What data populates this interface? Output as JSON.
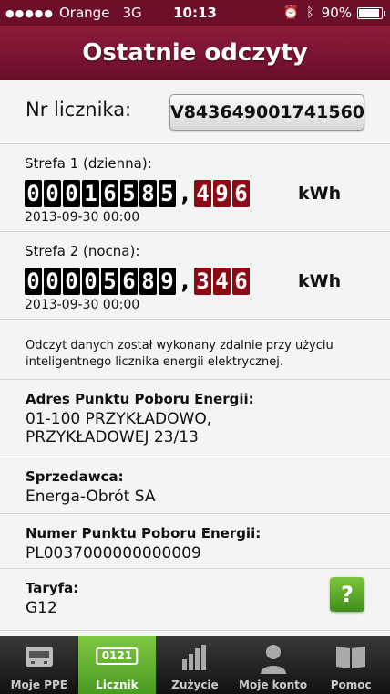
{
  "status_bar": {
    "signal": "●●●●●",
    "carrier": "Orange",
    "network": "3G",
    "time": "10:13",
    "battery": "90%"
  },
  "header": {
    "title": "Ostatnie odczyty"
  },
  "meter": {
    "label": "Nr licznika:",
    "number": "V843649001741560"
  },
  "zones": [
    {
      "label": "Strefa 1 (dzienna):",
      "digits_int": [
        "0",
        "0",
        "0",
        "1",
        "6",
        "5",
        "8",
        "5"
      ],
      "digits_dec": [
        "4",
        "9",
        "6"
      ],
      "unit": "kWh",
      "date": "2013-09-30 00:00"
    },
    {
      "label": "Strefa 2 (nocna):",
      "digits_int": [
        "0",
        "0",
        "0",
        "0",
        "5",
        "6",
        "8",
        "9"
      ],
      "digits_dec": [
        "3",
        "4",
        "6"
      ],
      "unit": "kWh",
      "date": "2013-09-30 00:00"
    }
  ],
  "note": "Odczyt danych został wykonany zdalnie przy użyciu inteligentnego licznika energii elektrycznej.",
  "address": {
    "label": "Adres Punktu Poboru Energii:",
    "line1": "01-100 PRZYKŁADOWO,",
    "line2": "PRZYKŁADOWEJ 23/13"
  },
  "seller": {
    "label": "Sprzedawca:",
    "value": "Energa-Obrót SA"
  },
  "ppe": {
    "label": "Numer Punktu Poboru Energii:",
    "value": "PL0037000000000009"
  },
  "tariff": {
    "label": "Taryfa:",
    "value": "G12",
    "help": "?"
  },
  "tabs": [
    {
      "label": "Moje PPE",
      "icon": "meter-device-icon"
    },
    {
      "label": "Licznik",
      "icon": "counter-icon",
      "icon_text": "0121",
      "active": true
    },
    {
      "label": "Zużycie",
      "icon": "bar-chart-icon"
    },
    {
      "label": "Moje konto",
      "icon": "user-icon"
    },
    {
      "label": "Pomoc",
      "icon": "book-icon"
    }
  ],
  "colors": {
    "header": "#7c1432",
    "accent_green": "#5aab2c",
    "digit_red": "#8b0a14"
  }
}
